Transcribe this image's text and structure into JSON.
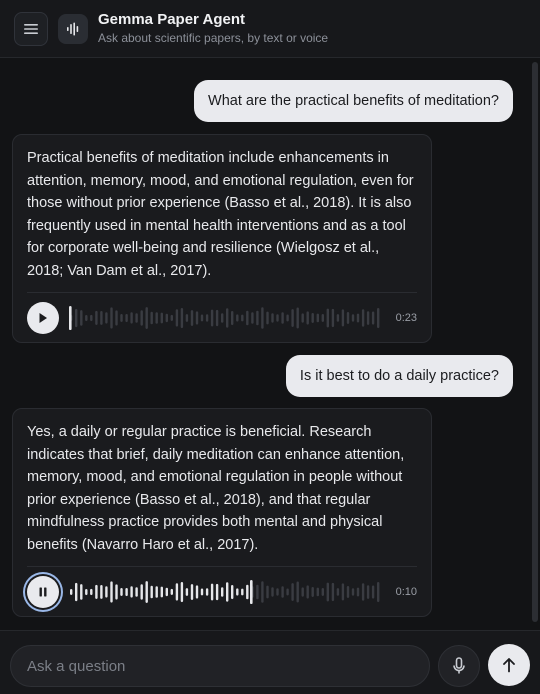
{
  "app": {
    "title": "Gemma Paper Agent",
    "subtitle": "Ask about scientific papers, by text or voice"
  },
  "icons": {
    "menu": "menu-icon",
    "app": "waveform-icon",
    "play": "play-icon",
    "pause": "pause-icon",
    "mic": "microphone-icon",
    "send": "arrow-up-icon"
  },
  "colors": {
    "background": "#121315",
    "user_bubble": "#e9eaee",
    "card": "#1a1b1e",
    "waveform_played": "#e6e7ea",
    "waveform_unplayed": "#3a3c42",
    "focus_ring": "#9ab8e8"
  },
  "messages": [
    {
      "role": "user",
      "text": "What are the practical benefits of meditation?"
    },
    {
      "role": "assistant",
      "text": "Practical benefits of meditation include enhancements in attention, memory, mood, and emotional regulation, even for those without prior experience (Basso et al., 2018). It is also frequently used in mental health interventions and as a tool for corporate well-being and resilience (Wielgosz et al., 2018; Van Dam et al., 2017).",
      "audio": {
        "state": "paused",
        "duration": "0:23",
        "progress": 0.0
      }
    },
    {
      "role": "user",
      "text": "Is it best to do a daily practice?"
    },
    {
      "role": "assistant",
      "text": "Yes, a daily or regular practice is beneficial. Research indicates that brief, daily meditation can enhance attention, memory, mood, and emotional regulation in people without prior experience (Basso et al., 2018), and that regular mindfulness practice provides both mental and physical benefits (Navarro Haro et al., 2017).",
      "audio": {
        "state": "playing",
        "duration": "0:10",
        "progress": 0.58
      }
    }
  ],
  "composer": {
    "placeholder": "Ask a question",
    "value": ""
  }
}
